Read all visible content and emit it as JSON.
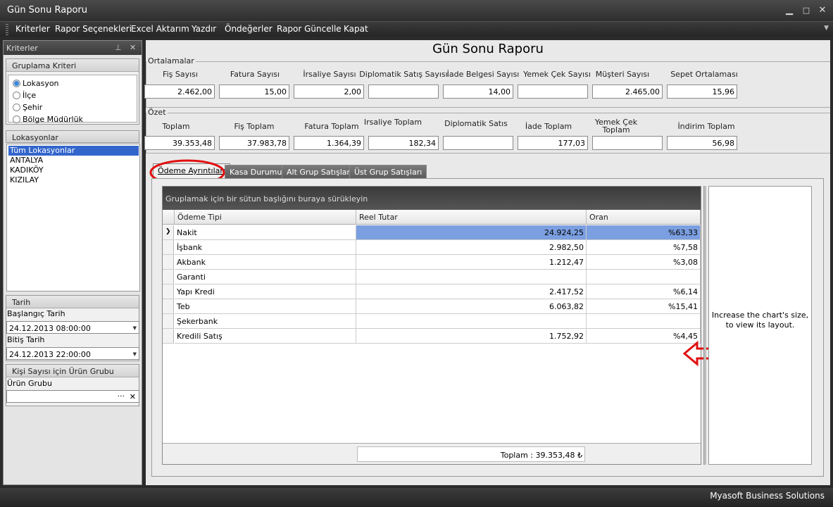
{
  "window": {
    "title": "Gün Sonu Raporu"
  },
  "menu": [
    "Kriterler",
    "Rapor Seçenekleri",
    "Excel Aktarım",
    "Yazdır",
    "Öndeğerler",
    "Rapor Güncelle",
    "Kapat"
  ],
  "left_panel": {
    "title": "Kriterler",
    "grouping": {
      "title": "Gruplama Kriteri",
      "options": [
        "Lokasyon",
        "İlçe",
        "Şehir",
        "Bölge Müdürlük"
      ],
      "selected": "Lokasyon"
    },
    "locations": {
      "title": "Lokasyonlar",
      "items": [
        "Tüm Lokasyonlar",
        "ANTALYA",
        "KADIKÖY",
        "KIZILAY"
      ],
      "selected": "Tüm Lokasyonlar"
    },
    "date": {
      "title": "Tarih",
      "start_label": "Başlangıç Tarih",
      "start_value": "24.12.2013 08:00:00",
      "end_label": "Bitiş Tarih",
      "end_value": "24.12.2013 22:00:00"
    },
    "product_group": {
      "title": "Kişi Sayısı için Ürün Grubu",
      "label": "Ürün Grubu",
      "value": "",
      "more_button": "···",
      "clear_button": "✕"
    }
  },
  "report": {
    "title": "Gün Sonu Raporu",
    "averages": {
      "title": "Ortalamalar",
      "fields": [
        {
          "label": "Fiş Sayısı",
          "value": "2.462,00"
        },
        {
          "label": "Fatura Sayısı",
          "value": "15,00"
        },
        {
          "label": "İrsaliye Sayısı",
          "value": "2,00"
        },
        {
          "label": "Diplomatik Satış Sayısı",
          "value": ""
        },
        {
          "label": "İade Belgesi Sayısı",
          "value": "14,00"
        },
        {
          "label": "Yemek Çek Sayısı",
          "value": ""
        },
        {
          "label": "Müşteri Sayısı",
          "value": "2.465,00"
        },
        {
          "label": "Sepet Ortalaması",
          "value": "15,96"
        }
      ]
    },
    "summary": {
      "title": "Özet",
      "fields": [
        {
          "label": "Toplam",
          "value": "39.353,48"
        },
        {
          "label": "Fiş Toplam",
          "value": "37.983,78"
        },
        {
          "label": "Fatura Toplam",
          "value": "1.364,39"
        },
        {
          "label": "Irsaliye Toplam",
          "value": "182,34"
        },
        {
          "label": "Diplomatik Satıs",
          "value": ""
        },
        {
          "label": "İade Toplam",
          "value": "177,03"
        },
        {
          "label": "Yemek Çek Toplam",
          "value": ""
        },
        {
          "label": "İndirim Toplam",
          "value": "56,98"
        }
      ]
    },
    "tabs": [
      "Ödeme Ayrıntıları",
      "Kasa Durumu",
      "Alt Grup Satışları",
      "Üst Grup Satışları"
    ],
    "active_tab": "Ödeme Ayrıntıları",
    "grid": {
      "group_hint": "Gruplamak için bir sütun başlığını buraya sürükleyin",
      "columns": [
        "Ödeme Tipi",
        "Reel Tutar",
        "Oran"
      ],
      "rows": [
        {
          "type": "Nakit",
          "amount": "24.924,25",
          "ratio": "%63,33"
        },
        {
          "type": "İşbank",
          "amount": "2.982,50",
          "ratio": "%7,58"
        },
        {
          "type": "Akbank",
          "amount": "1.212,47",
          "ratio": "%3,08"
        },
        {
          "type": "Garanti",
          "amount": "",
          "ratio": ""
        },
        {
          "type": "Yapı Kredi",
          "amount": "2.417,52",
          "ratio": "%6,14"
        },
        {
          "type": "Teb",
          "amount": "6.063,82",
          "ratio": "%15,41"
        },
        {
          "type": "Şekerbank",
          "amount": "",
          "ratio": ""
        },
        {
          "type": "Kredili Satış",
          "amount": "1.752,92",
          "ratio": "%4,45"
        }
      ],
      "footer_total": "Toplam : 39.353,48 ₺"
    },
    "chart_message": "Increase the chart's size, to view its layout."
  },
  "status": {
    "text": "Myasoft Business Solutions"
  },
  "colors": {
    "selection": "#3366cc",
    "highlight_row": "#7b9fe0",
    "annotation": "#e01010"
  }
}
